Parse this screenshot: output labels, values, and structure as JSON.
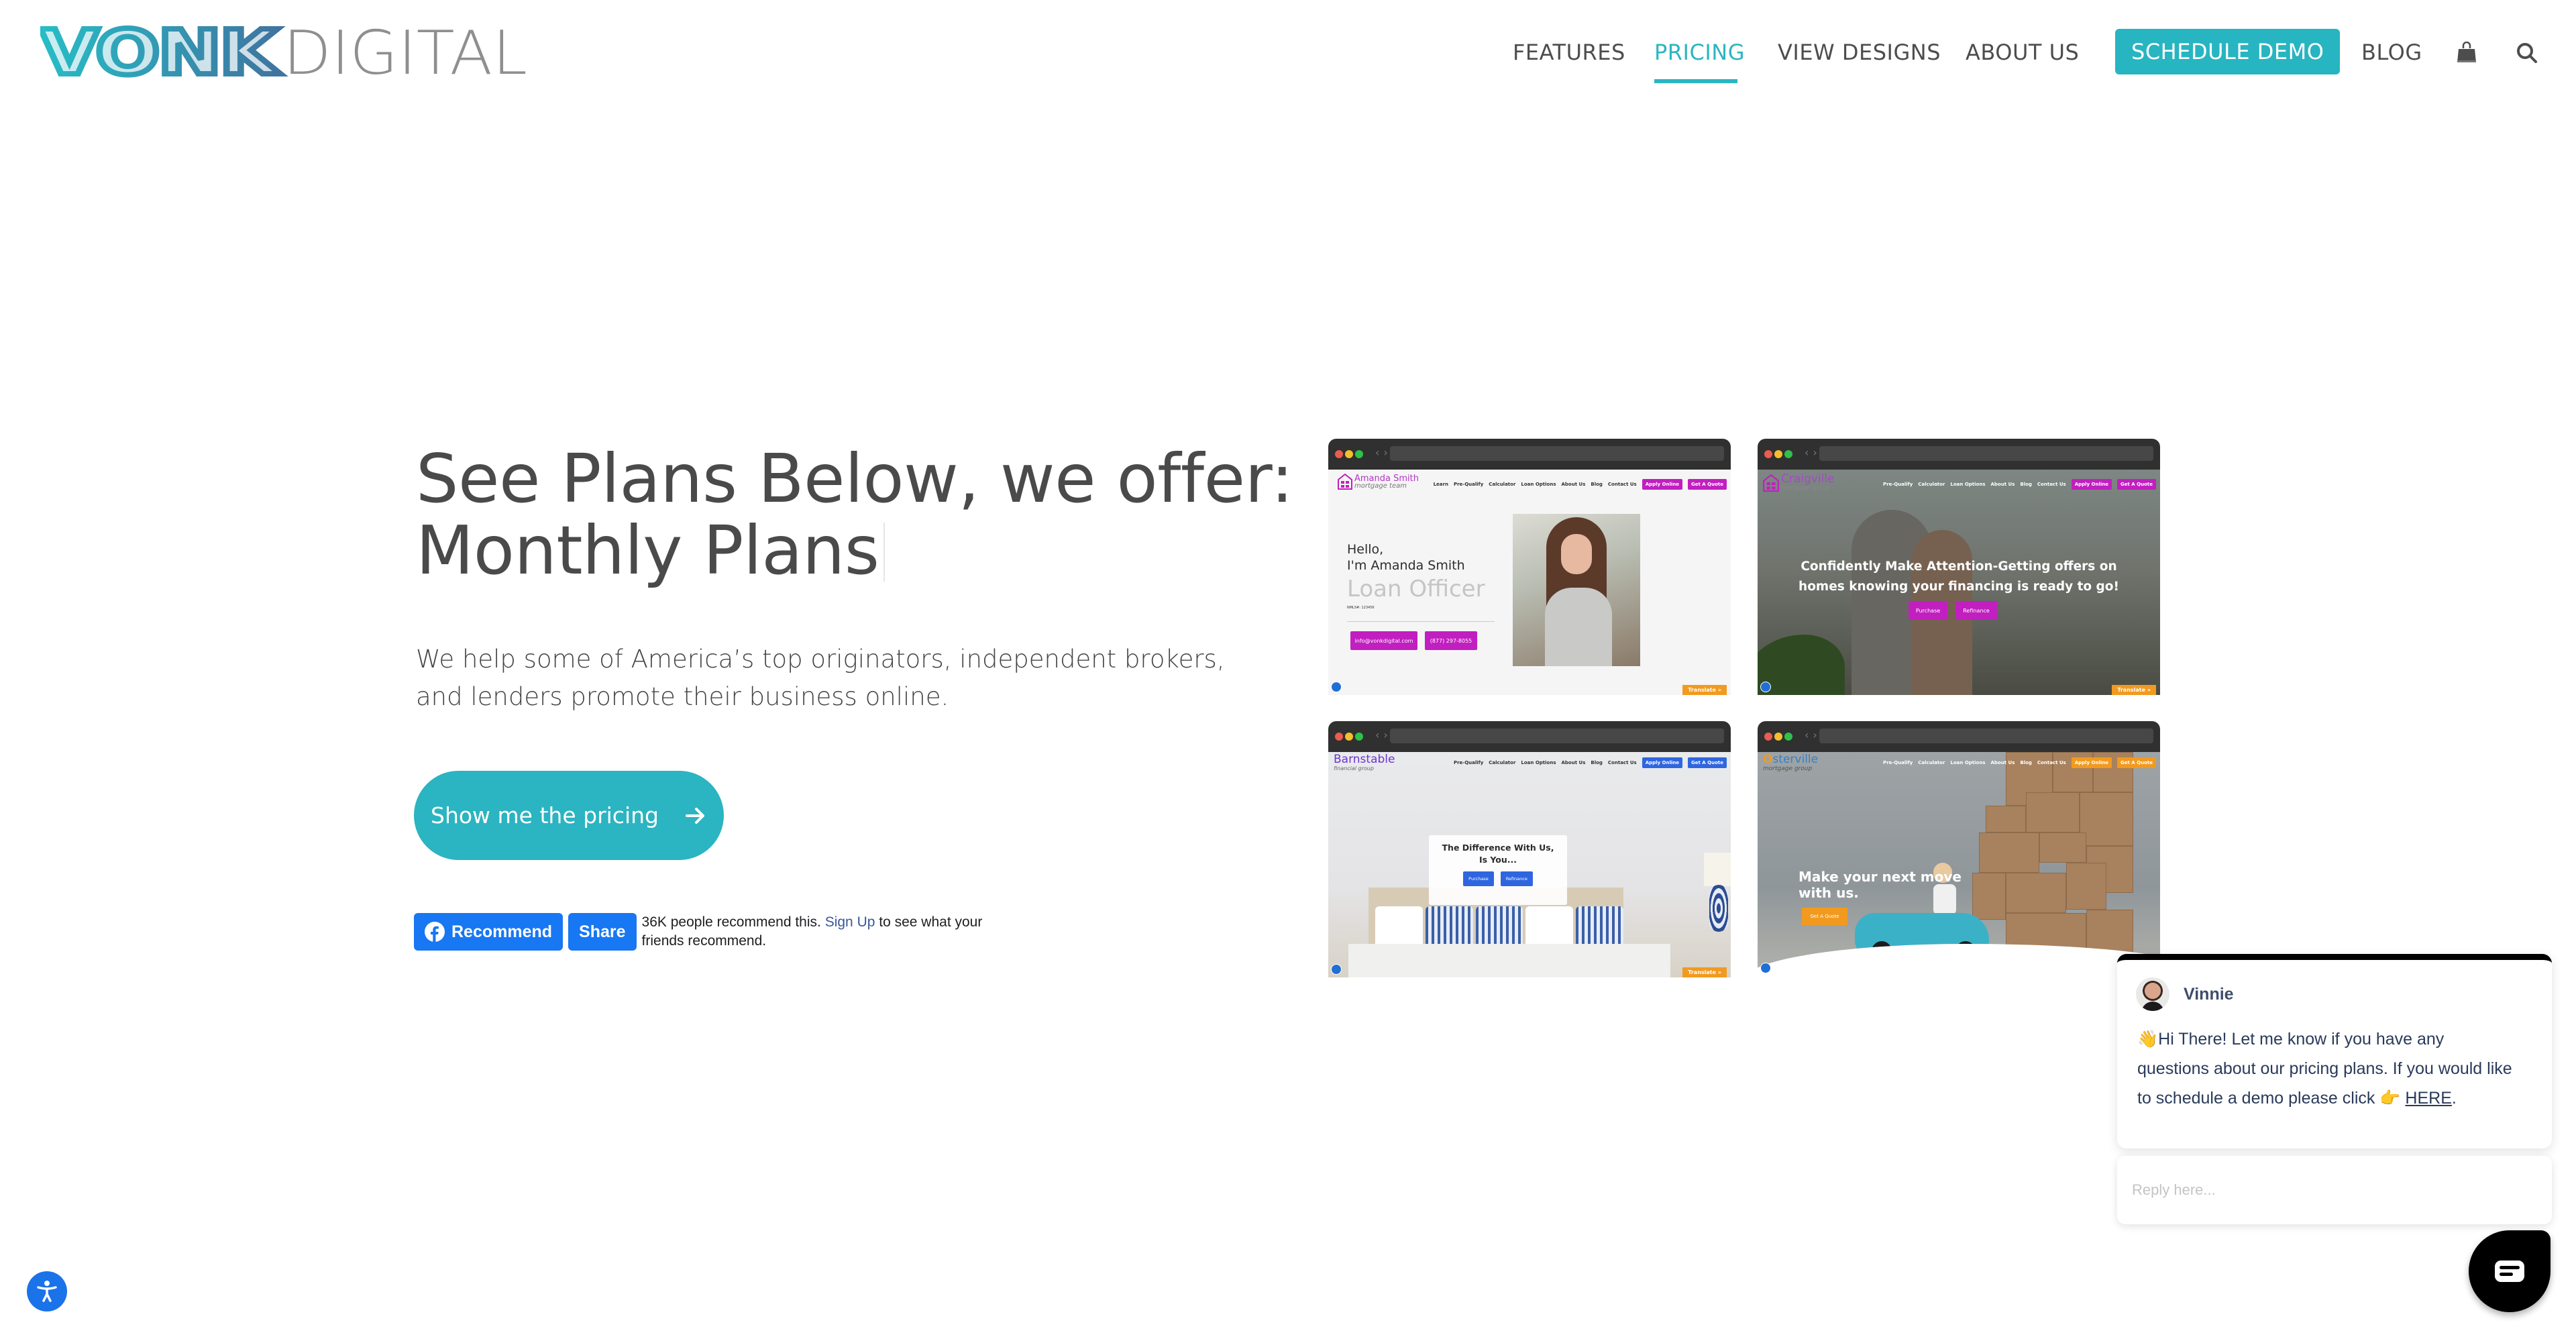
{
  "brand": {
    "logo_primary": "VONK",
    "logo_secondary": "DIGITAL",
    "colors": {
      "teal": "#2bb6c2",
      "steel_blue": "#3d77a0",
      "gray": "#8f8f8f",
      "text": "#4a4a4a"
    }
  },
  "nav": {
    "items": [
      {
        "label": "FEATURES",
        "active": false
      },
      {
        "label": "PRICING",
        "active": true
      },
      {
        "label": "VIEW DESIGNS",
        "active": false
      },
      {
        "label": "ABOUT US",
        "active": false
      }
    ],
    "cta_label": "SCHEDULE DEMO",
    "blog_label": "BLOG",
    "icons": [
      "shopping-bag-icon",
      "search-icon"
    ]
  },
  "hero": {
    "title_line1": "See Plans Below, we offer:",
    "title_line2": "Monthly Plans",
    "subtitle": "We help some of America’s top originators, independent brokers, and lenders promote their business online.",
    "pricing_button": "Show me the pricing",
    "pricing_button_icon": "arrow-right-icon"
  },
  "facebook": {
    "recommend_label": "Recommend",
    "share_label": "Share",
    "text_before": "36K people recommend this.",
    "signup_link": "Sign Up",
    "text_after": "to see what your friends recommend."
  },
  "showcase": [
    {
      "brand_name": "Amanda Smith",
      "brand_sub": "mortgage team",
      "nav": [
        "Learn",
        "Pre-Qualify",
        "Calculator",
        "Loan Options",
        "About Us",
        "Blog",
        "Contact Us"
      ],
      "buttons": [
        "Apply Online",
        "Get A Quote"
      ],
      "greeting_line1": "Hello,",
      "greeting_line2": "I'm Amanda Smith",
      "role": "Loan Officer",
      "nmls": "NMLS#: 123456",
      "email": "info@vonkdigital.com",
      "phone": "(877) 297-8055",
      "translate": "Translate »",
      "accent": "#c11fc0"
    },
    {
      "brand_name": "Craigville",
      "brand_sub": "mortgage group",
      "nav": [
        "Pre-Qualify",
        "Calculator",
        "Loan Options",
        "About Us",
        "Blog",
        "Contact Us"
      ],
      "buttons": [
        "Apply Online",
        "Get A Quote"
      ],
      "headline_line1": "Confidently Make Attention-Getting offers on",
      "headline_line2": "homes knowing your financing is ready to go!",
      "ctas": [
        "Purchase",
        "Refinance"
      ],
      "translate": "Translate »",
      "accent": "#c11fc0"
    },
    {
      "brand_name": "Barnstable",
      "brand_sub": "financial group",
      "nav": [
        "Pre-Qualify",
        "Calculator",
        "Loan Options",
        "About Us",
        "Blog",
        "Contact Us"
      ],
      "buttons": [
        "Apply Online",
        "Get A Quote"
      ],
      "headline_line1": "The Difference With Us,",
      "headline_line2": "Is You...",
      "ctas": [
        "Purchase",
        "Refinance"
      ],
      "translate": "Translate »",
      "accent": "#2f66e0"
    },
    {
      "brand_name_first": "O",
      "brand_name_rest": "sterville",
      "brand_sub": "mortgage group",
      "nav": [
        "Pre-Qualify",
        "Calculator",
        "Loan Options",
        "About Us",
        "Blog",
        "Contact Us"
      ],
      "buttons": [
        "Apply Online",
        "Get A Quote"
      ],
      "headline_line1": "Make your next move",
      "headline_line2": "with us.",
      "cta": "Get A Quote",
      "accent": "#f29a1f"
    }
  ],
  "chat": {
    "agent_name": "Vinnie",
    "message_emoji": "👋",
    "message": "Hi There! Let me know if you have any questions about our pricing plans. If you would like to schedule a demo please click",
    "pointer_emoji": "👉",
    "link_label": "HERE",
    "message_end": ".",
    "reply_placeholder": "Reply here..."
  },
  "accessibility": {
    "icon": "accessibility-icon"
  }
}
